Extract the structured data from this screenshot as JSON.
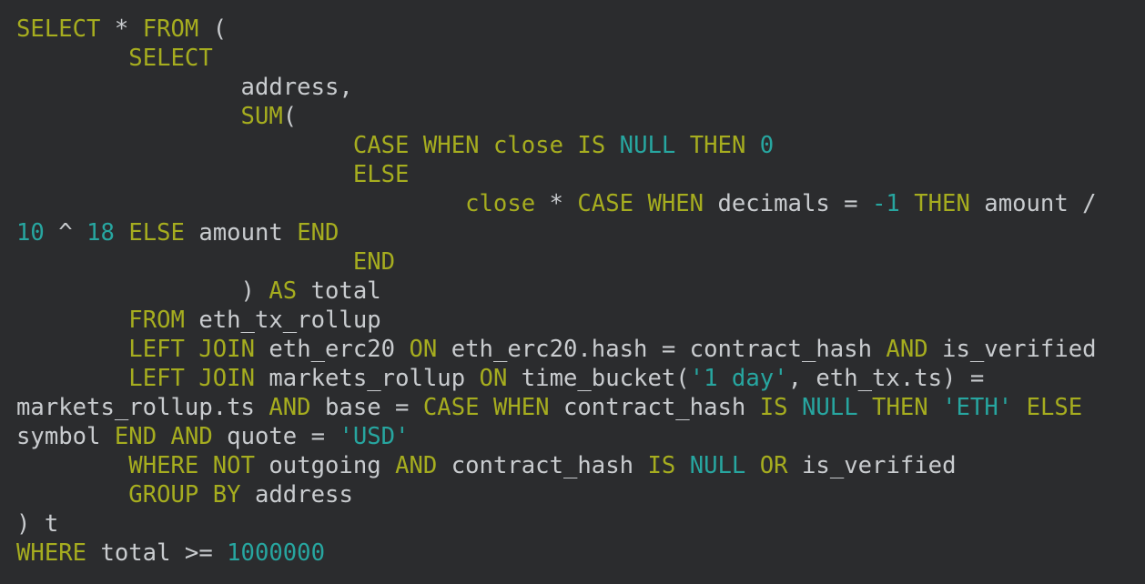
{
  "colors": {
    "background": "#2b2c2e",
    "keyword": "#a6ad1f",
    "number_and_string": "#27a6a0",
    "identifier": "#c9cccf"
  },
  "code_lines": [
    [
      {
        "t": "SELECT",
        "c": "kw"
      },
      {
        "t": " * ",
        "c": "op"
      },
      {
        "t": "FROM",
        "c": "kw"
      },
      {
        "t": " (",
        "c": "op"
      }
    ],
    [
      {
        "t": "        ",
        "c": "id"
      },
      {
        "t": "SELECT",
        "c": "kw"
      }
    ],
    [
      {
        "t": "                address,",
        "c": "id"
      }
    ],
    [
      {
        "t": "                ",
        "c": "id"
      },
      {
        "t": "SUM",
        "c": "kw"
      },
      {
        "t": "(",
        "c": "op"
      }
    ],
    [
      {
        "t": "                        ",
        "c": "id"
      },
      {
        "t": "CASE",
        "c": "kw"
      },
      {
        "t": " ",
        "c": "id"
      },
      {
        "t": "WHEN",
        "c": "kw"
      },
      {
        "t": " ",
        "c": "id"
      },
      {
        "t": "close",
        "c": "kw"
      },
      {
        "t": " ",
        "c": "id"
      },
      {
        "t": "IS",
        "c": "kw"
      },
      {
        "t": " ",
        "c": "id"
      },
      {
        "t": "NULL",
        "c": "nu"
      },
      {
        "t": " ",
        "c": "id"
      },
      {
        "t": "THEN",
        "c": "kw"
      },
      {
        "t": " ",
        "c": "id"
      },
      {
        "t": "0",
        "c": "nu"
      }
    ],
    [
      {
        "t": "                        ",
        "c": "id"
      },
      {
        "t": "ELSE",
        "c": "kw"
      }
    ],
    [
      {
        "t": "                                ",
        "c": "id"
      },
      {
        "t": "close",
        "c": "kw"
      },
      {
        "t": " * ",
        "c": "op"
      },
      {
        "t": "CASE",
        "c": "kw"
      },
      {
        "t": " ",
        "c": "id"
      },
      {
        "t": "WHEN",
        "c": "kw"
      },
      {
        "t": " decimals = ",
        "c": "id"
      },
      {
        "t": "-1",
        "c": "nu"
      },
      {
        "t": " ",
        "c": "id"
      },
      {
        "t": "THEN",
        "c": "kw"
      },
      {
        "t": " amount /",
        "c": "id"
      }
    ],
    [
      {
        "t": "10",
        "c": "nu"
      },
      {
        "t": " ^ ",
        "c": "op"
      },
      {
        "t": "18",
        "c": "nu"
      },
      {
        "t": " ",
        "c": "id"
      },
      {
        "t": "ELSE",
        "c": "kw"
      },
      {
        "t": " amount ",
        "c": "id"
      },
      {
        "t": "END",
        "c": "kw"
      }
    ],
    [
      {
        "t": "                        ",
        "c": "id"
      },
      {
        "t": "END",
        "c": "kw"
      }
    ],
    [
      {
        "t": "                ) ",
        "c": "id"
      },
      {
        "t": "AS",
        "c": "kw"
      },
      {
        "t": " total",
        "c": "id"
      }
    ],
    [
      {
        "t": "        ",
        "c": "id"
      },
      {
        "t": "FROM",
        "c": "kw"
      },
      {
        "t": " eth_tx_rollup",
        "c": "id"
      }
    ],
    [
      {
        "t": "        ",
        "c": "id"
      },
      {
        "t": "LEFT",
        "c": "kw"
      },
      {
        "t": " ",
        "c": "id"
      },
      {
        "t": "JOIN",
        "c": "kw"
      },
      {
        "t": " eth_erc20 ",
        "c": "id"
      },
      {
        "t": "ON",
        "c": "kw"
      },
      {
        "t": " eth_erc20.hash = contract_hash ",
        "c": "id"
      },
      {
        "t": "AND",
        "c": "kw"
      },
      {
        "t": " is_verified",
        "c": "id"
      }
    ],
    [
      {
        "t": "        ",
        "c": "id"
      },
      {
        "t": "LEFT",
        "c": "kw"
      },
      {
        "t": " ",
        "c": "id"
      },
      {
        "t": "JOIN",
        "c": "kw"
      },
      {
        "t": " markets_rollup ",
        "c": "id"
      },
      {
        "t": "ON",
        "c": "kw"
      },
      {
        "t": " time_bucket(",
        "c": "id"
      },
      {
        "t": "'1 day'",
        "c": "st"
      },
      {
        "t": ", eth_tx.ts) =",
        "c": "id"
      }
    ],
    [
      {
        "t": "markets_rollup.ts ",
        "c": "id"
      },
      {
        "t": "AND",
        "c": "kw"
      },
      {
        "t": " base = ",
        "c": "id"
      },
      {
        "t": "CASE",
        "c": "kw"
      },
      {
        "t": " ",
        "c": "id"
      },
      {
        "t": "WHEN",
        "c": "kw"
      },
      {
        "t": " contract_hash ",
        "c": "id"
      },
      {
        "t": "IS",
        "c": "kw"
      },
      {
        "t": " ",
        "c": "id"
      },
      {
        "t": "NULL",
        "c": "nu"
      },
      {
        "t": " ",
        "c": "id"
      },
      {
        "t": "THEN",
        "c": "kw"
      },
      {
        "t": " ",
        "c": "id"
      },
      {
        "t": "'ETH'",
        "c": "st"
      },
      {
        "t": " ",
        "c": "id"
      },
      {
        "t": "ELSE",
        "c": "kw"
      }
    ],
    [
      {
        "t": "symbol ",
        "c": "id"
      },
      {
        "t": "END",
        "c": "kw"
      },
      {
        "t": " ",
        "c": "id"
      },
      {
        "t": "AND",
        "c": "kw"
      },
      {
        "t": " quote = ",
        "c": "id"
      },
      {
        "t": "'USD'",
        "c": "st"
      }
    ],
    [
      {
        "t": "        ",
        "c": "id"
      },
      {
        "t": "WHERE",
        "c": "kw"
      },
      {
        "t": " ",
        "c": "id"
      },
      {
        "t": "NOT",
        "c": "kw"
      },
      {
        "t": " outgoing ",
        "c": "id"
      },
      {
        "t": "AND",
        "c": "kw"
      },
      {
        "t": " contract_hash ",
        "c": "id"
      },
      {
        "t": "IS",
        "c": "kw"
      },
      {
        "t": " ",
        "c": "id"
      },
      {
        "t": "NULL",
        "c": "nu"
      },
      {
        "t": " ",
        "c": "id"
      },
      {
        "t": "OR",
        "c": "kw"
      },
      {
        "t": " is_verified",
        "c": "id"
      }
    ],
    [
      {
        "t": "        ",
        "c": "id"
      },
      {
        "t": "GROUP",
        "c": "kw"
      },
      {
        "t": " ",
        "c": "id"
      },
      {
        "t": "BY",
        "c": "kw"
      },
      {
        "t": " address",
        "c": "id"
      }
    ],
    [
      {
        "t": ") t",
        "c": "id"
      }
    ],
    [
      {
        "t": "WHERE",
        "c": "kw"
      },
      {
        "t": " total >= ",
        "c": "id"
      },
      {
        "t": "1000000",
        "c": "nu"
      }
    ]
  ]
}
